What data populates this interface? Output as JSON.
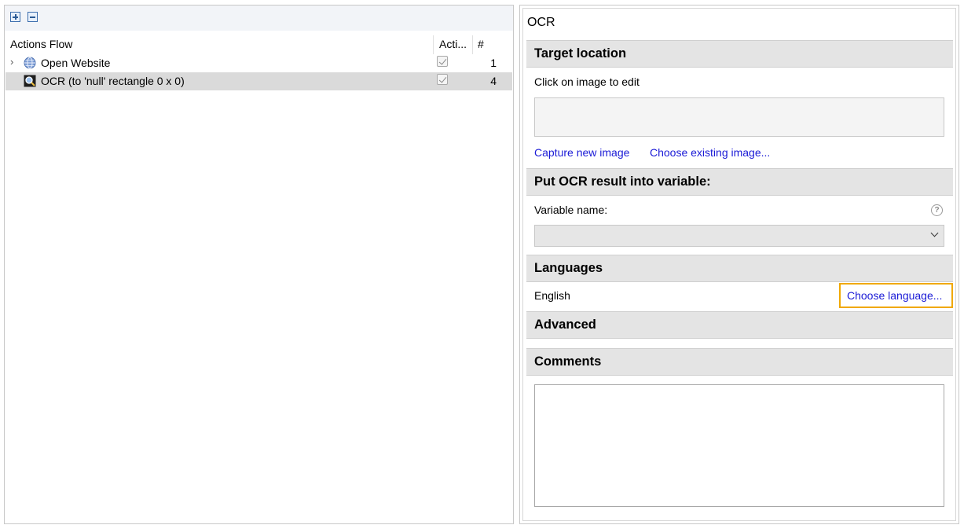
{
  "toolbar": {
    "expand_icon": "expand-all-icon",
    "collapse_icon": "collapse-all-icon"
  },
  "tree": {
    "columns": [
      "Actions Flow",
      "Acti...",
      "#"
    ],
    "rows": [
      {
        "label": "Open Website",
        "icon": "globe-icon",
        "enabled": true,
        "number": "1",
        "expandable": true,
        "selected": false
      },
      {
        "label": "OCR (to 'null' rectangle 0 x 0)",
        "icon": "ocr-magnifier-icon",
        "enabled": true,
        "number": "4",
        "expandable": false,
        "selected": true
      }
    ]
  },
  "properties": {
    "title": "OCR",
    "target_location": {
      "header": "Target location",
      "hint": "Click on image to edit",
      "capture_link": "Capture new image",
      "choose_link": "Choose existing image..."
    },
    "variable": {
      "header": "Put OCR result into variable:",
      "label": "Variable name:",
      "value": ""
    },
    "languages": {
      "header": "Languages",
      "current": "English",
      "choose_link": "Choose language..."
    },
    "advanced": {
      "header": "Advanced"
    },
    "comments": {
      "header": "Comments",
      "value": ""
    }
  },
  "colors": {
    "link": "#1a1ad6",
    "focus_highlight": "#f0a800",
    "selected_row": "#dadada",
    "section_header": "#e4e4e4"
  }
}
